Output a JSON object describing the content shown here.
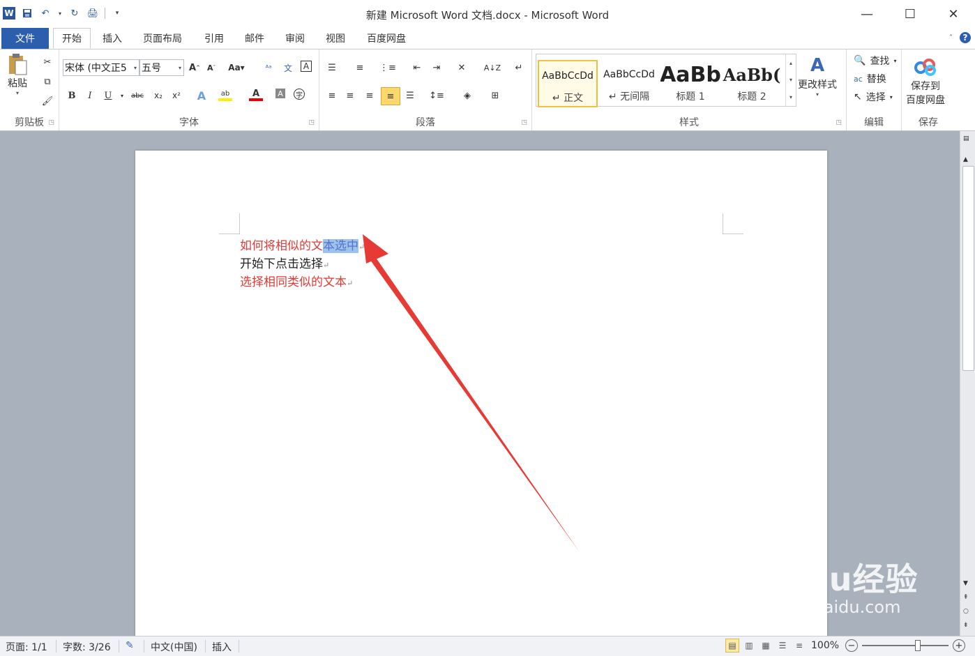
{
  "window": {
    "title": "新建 Microsoft Word 文档.docx - Microsoft Word"
  },
  "qat": {
    "icons": [
      "word-logo",
      "save-icon",
      "undo-icon",
      "redo-icon",
      "print-preview-icon",
      "customize-icon"
    ]
  },
  "tabs": {
    "file": "文件",
    "items": [
      "开始",
      "插入",
      "页面布局",
      "引用",
      "邮件",
      "审阅",
      "视图",
      "百度网盘"
    ],
    "active": "开始"
  },
  "ribbon": {
    "clipboard": {
      "name": "剪贴板",
      "paste": "粘贴"
    },
    "font": {
      "name": "字体",
      "font_family": "宋体 (中文正5",
      "font_size": "五号"
    },
    "paragraph": {
      "name": "段落"
    },
    "styles": {
      "name": "样式",
      "items": [
        {
          "preview": "AaBbCcDd",
          "label": "↵ 正文"
        },
        {
          "preview": "AaBbCcDd",
          "label": "↵ 无间隔"
        },
        {
          "preview": "AaBb",
          "label": "标题 1"
        },
        {
          "preview": "AaBb(",
          "label": "标题 2"
        }
      ],
      "change": "更改样式"
    },
    "editing": {
      "name": "编辑",
      "find": "查找",
      "replace": "替换",
      "select": "选择"
    },
    "save": {
      "name": "保存",
      "button": "保存到\n百度网盘"
    }
  },
  "document": {
    "line1_pre": "如何将相似的文",
    "line1_sel": "本选中",
    "line2": "开始下点击选择",
    "line3": "选择相同类似的文本",
    "pilcrow": "↵",
    "colors": {
      "red_text": "#e53935",
      "selection": "#9cc3ea",
      "arrow": "#e83a35"
    }
  },
  "status": {
    "page": "页面: 1/1",
    "words": "字数: 3/26",
    "language": "中文(中国)",
    "mode": "插入",
    "zoom": "100%"
  },
  "watermark": {
    "line1": "Baidu经验",
    "line2": "jingyan.baidu.com"
  }
}
